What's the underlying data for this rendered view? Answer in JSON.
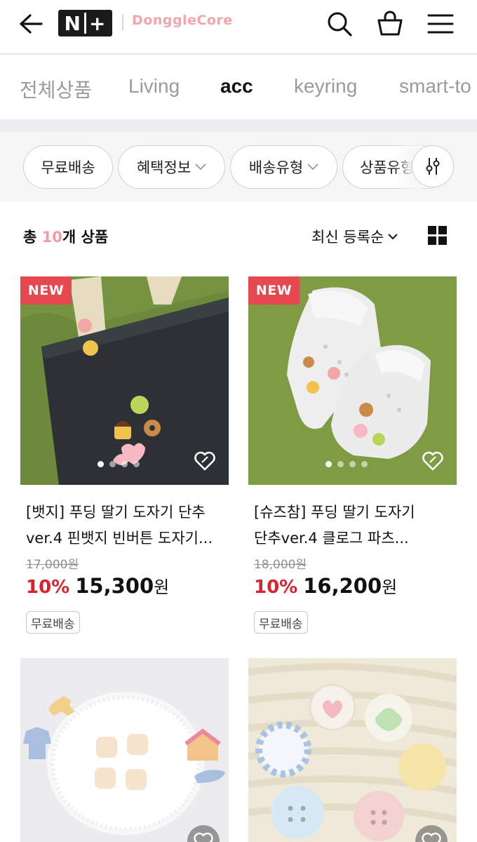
{
  "header": {
    "logo_text": "N+",
    "brand_name": "DonggleCore",
    "icons": [
      "back-arrow-icon",
      "search-icon",
      "shopping-bag-icon",
      "hamburger-menu-icon"
    ]
  },
  "categories": [
    {
      "label": "전체상품",
      "active": false
    },
    {
      "label": "Living",
      "active": false
    },
    {
      "label": "acc",
      "active": true
    },
    {
      "label": "keyring",
      "active": false
    },
    {
      "label": "smart-to",
      "active": false
    }
  ],
  "filters": [
    "무료배송",
    "혜택정보",
    "배송유형",
    "상품유형"
  ],
  "summary": {
    "prefix": "총 ",
    "count": "10",
    "suffix": "개 상품",
    "sort_label": "최신 등록순"
  },
  "products": [
    {
      "badge": "NEW",
      "name": "[뱃지] 푸딩 딸기 도자기 단추ver.4 핀뱃지 빈버튼 도자기...",
      "name_line1": "[뱃지] 푸딩 딸기 도자기 단추",
      "name_line2": "ver.4 핀뱃지 빈버튼 도자기...",
      "original_price": "17,000원",
      "discount": "10%",
      "price": "15,300",
      "currency": "원",
      "shipping_tag": "무료배송"
    },
    {
      "badge": "NEW",
      "name": "[슈즈참] 푸딩 딸기 도자기 단추ver.4 클로그 파츠...",
      "name_line1": "[슈즈참] 푸딩 딸기 도자기",
      "name_line2": "단추ver.4 클로그 파츠...",
      "original_price": "18,000원",
      "discount": "10%",
      "price": "16,200",
      "currency": "원",
      "shipping_tag": "무료배송"
    },
    {
      "badge": "",
      "name": ""
    },
    {
      "badge": "",
      "name": ""
    }
  ],
  "colors": {
    "accent_pink": "#f29aa6",
    "new_badge": "#e5494f",
    "discount_red": "#d9232f"
  }
}
